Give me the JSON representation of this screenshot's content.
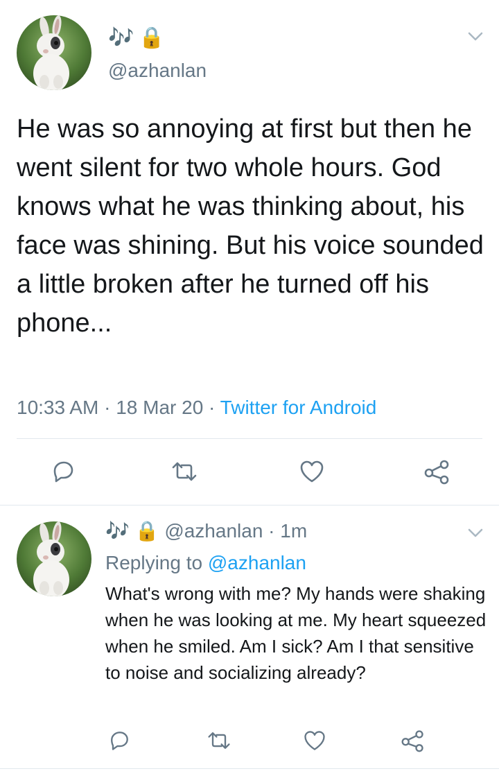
{
  "main_tweet": {
    "emoji_music": "🎶",
    "emoji_lock": "🔒",
    "handle": "@azhanlan",
    "text": "He was so annoying at first but then he went silent for two whole hours. God knows what he was thinking about, his face was shining. But his voice sounded a little broken after he turned off his phone...",
    "time": "10:33 AM",
    "sep1": " · ",
    "date": "18 Mar 20",
    "sep2": " · ",
    "client": "Twitter for Android",
    "actions": {
      "reply_icon": "reply-icon",
      "retweet_icon": "retweet-icon",
      "like_icon": "heart-icon",
      "share_icon": "share-icon"
    }
  },
  "reply_tweet": {
    "emoji_music": "🎶",
    "emoji_lock": "🔒",
    "handle": "@azhanlan",
    "sep": " · ",
    "age": "1m",
    "replying_prefix": "Replying to ",
    "replying_handle": "@azhanlan",
    "text": "What's wrong with me? My hands were shaking when he was looking at me. My heart squeezed when he smiled. Am I sick? Am I that sensitive to noise and socializing already?"
  },
  "colors": {
    "text": "#14171a",
    "muted": "#657786",
    "link": "#1da1f2",
    "divider": "#e1e8ed"
  }
}
